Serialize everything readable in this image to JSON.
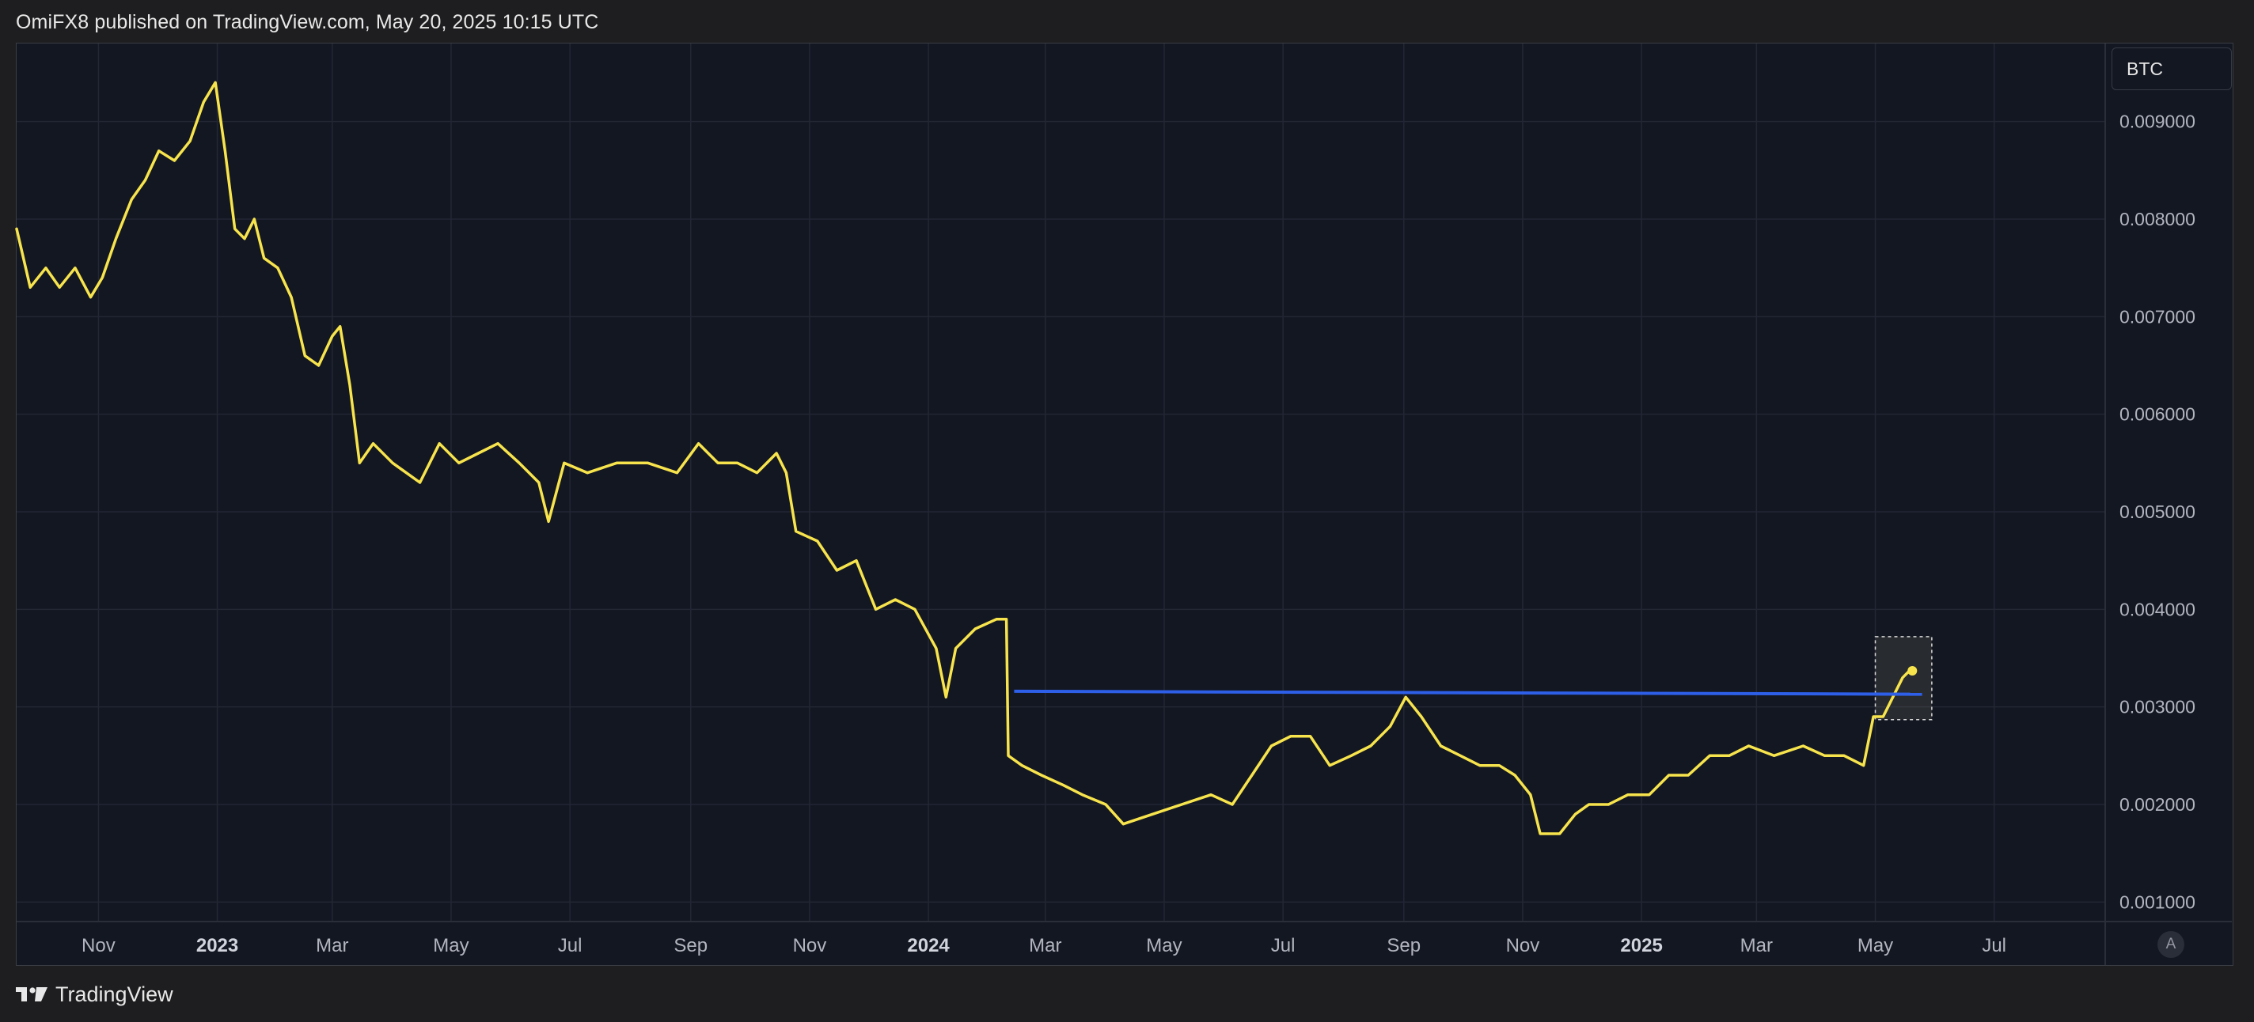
{
  "header": {
    "published_text": "OmiFX8 published on TradingView.com, May 20, 2025 10:15 UTC"
  },
  "symbol": {
    "label": "BTC"
  },
  "scale_button": {
    "label": "A"
  },
  "footer": {
    "brand": "TradingView"
  },
  "colors": {
    "background": "#131722",
    "grid": "#232734",
    "price_line": "#f7e44d",
    "horizontal_line": "#2d5fe8",
    "axis_text": "#b2b5be"
  },
  "chart_data": {
    "type": "line",
    "title": "",
    "xlabel": "",
    "ylabel": "",
    "x_range": [
      "2022-09-20",
      "2025-08-27"
    ],
    "ylim": [
      0.0008,
      0.0098
    ],
    "grid": true,
    "y_ticks": [
      "0.009000",
      "0.008000",
      "0.007000",
      "0.006000",
      "0.005000",
      "0.004000",
      "0.003000",
      "0.002000",
      "0.001000"
    ],
    "x_ticks": [
      {
        "date": "2022-11-01",
        "label": "Nov",
        "bold": false
      },
      {
        "date": "2023-01-01",
        "label": "2023",
        "bold": true
      },
      {
        "date": "2023-03-01",
        "label": "Mar",
        "bold": false
      },
      {
        "date": "2023-05-01",
        "label": "May",
        "bold": false
      },
      {
        "date": "2023-07-01",
        "label": "Jul",
        "bold": false
      },
      {
        "date": "2023-09-01",
        "label": "Sep",
        "bold": false
      },
      {
        "date": "2023-11-01",
        "label": "Nov",
        "bold": false
      },
      {
        "date": "2024-01-01",
        "label": "2024",
        "bold": true
      },
      {
        "date": "2024-03-01",
        "label": "Mar",
        "bold": false
      },
      {
        "date": "2024-05-01",
        "label": "May",
        "bold": false
      },
      {
        "date": "2024-07-01",
        "label": "Jul",
        "bold": false
      },
      {
        "date": "2024-09-01",
        "label": "Sep",
        "bold": false
      },
      {
        "date": "2024-11-01",
        "label": "Nov",
        "bold": false
      },
      {
        "date": "2025-01-01",
        "label": "2025",
        "bold": true
      },
      {
        "date": "2025-03-01",
        "label": "Mar",
        "bold": false
      },
      {
        "date": "2025-05-01",
        "label": "May",
        "bold": false
      },
      {
        "date": "2025-07-01",
        "label": "Jul",
        "bold": false
      }
    ],
    "series": [
      {
        "values": [
          [
            "2022-09-20",
            0.0079
          ],
          [
            "2022-09-27",
            0.0073
          ],
          [
            "2022-10-05",
            0.0075
          ],
          [
            "2022-10-12",
            0.0073
          ],
          [
            "2022-10-20",
            0.0075
          ],
          [
            "2022-10-28",
            0.0072
          ],
          [
            "2022-11-03",
            0.0074
          ],
          [
            "2022-11-10",
            0.0078
          ],
          [
            "2022-11-18",
            0.0082
          ],
          [
            "2022-11-25",
            0.0084
          ],
          [
            "2022-12-02",
            0.0087
          ],
          [
            "2022-12-10",
            0.0086
          ],
          [
            "2022-12-18",
            0.0088
          ],
          [
            "2022-12-25",
            0.0092
          ],
          [
            "2022-12-31",
            0.0094
          ],
          [
            "2023-01-05",
            0.0087
          ],
          [
            "2023-01-10",
            0.0079
          ],
          [
            "2023-01-15",
            0.0078
          ],
          [
            "2023-01-20",
            0.008
          ],
          [
            "2023-01-25",
            0.0076
          ],
          [
            "2023-02-01",
            0.0075
          ],
          [
            "2023-02-08",
            0.0072
          ],
          [
            "2023-02-15",
            0.0066
          ],
          [
            "2023-02-22",
            0.0065
          ],
          [
            "2023-03-01",
            0.0068
          ],
          [
            "2023-03-05",
            0.0069
          ],
          [
            "2023-03-10",
            0.0063
          ],
          [
            "2023-03-15",
            0.0055
          ],
          [
            "2023-03-22",
            0.0057
          ],
          [
            "2023-04-01",
            0.0055
          ],
          [
            "2023-04-15",
            0.0053
          ],
          [
            "2023-04-25",
            0.0057
          ],
          [
            "2023-05-05",
            0.0055
          ],
          [
            "2023-05-15",
            0.0056
          ],
          [
            "2023-05-25",
            0.0057
          ],
          [
            "2023-06-05",
            0.0055
          ],
          [
            "2023-06-15",
            0.0053
          ],
          [
            "2023-06-20",
            0.0049
          ],
          [
            "2023-06-28",
            0.0055
          ],
          [
            "2023-07-10",
            0.0054
          ],
          [
            "2023-07-25",
            0.0055
          ],
          [
            "2023-08-10",
            0.0055
          ],
          [
            "2023-08-25",
            0.0054
          ],
          [
            "2023-09-05",
            0.0057
          ],
          [
            "2023-09-15",
            0.0055
          ],
          [
            "2023-09-25",
            0.0055
          ],
          [
            "2023-10-05",
            0.0054
          ],
          [
            "2023-10-15",
            0.0056
          ],
          [
            "2023-10-20",
            0.0054
          ],
          [
            "2023-10-25",
            0.0048
          ],
          [
            "2023-11-05",
            0.0047
          ],
          [
            "2023-11-15",
            0.0044
          ],
          [
            "2023-11-25",
            0.0045
          ],
          [
            "2023-12-05",
            0.004
          ],
          [
            "2023-12-15",
            0.0041
          ],
          [
            "2023-12-25",
            0.004
          ],
          [
            "2024-01-05",
            0.0036
          ],
          [
            "2024-01-10",
            0.0031
          ],
          [
            "2024-01-15",
            0.0036
          ],
          [
            "2024-01-25",
            0.0038
          ],
          [
            "2024-02-05",
            0.0039
          ],
          [
            "2024-02-10",
            0.0039
          ],
          [
            "2024-02-11",
            0.0025
          ],
          [
            "2024-02-18",
            0.0024
          ],
          [
            "2024-02-28",
            0.0023
          ],
          [
            "2024-03-10",
            0.0022
          ],
          [
            "2024-03-20",
            0.0021
          ],
          [
            "2024-04-01",
            0.002
          ],
          [
            "2024-04-10",
            0.0018
          ],
          [
            "2024-04-25",
            0.0019
          ],
          [
            "2024-05-10",
            0.002
          ],
          [
            "2024-05-25",
            0.0021
          ],
          [
            "2024-06-05",
            0.002
          ],
          [
            "2024-06-15",
            0.0023
          ],
          [
            "2024-06-25",
            0.0026
          ],
          [
            "2024-07-05",
            0.0027
          ],
          [
            "2024-07-15",
            0.0027
          ],
          [
            "2024-07-25",
            0.0024
          ],
          [
            "2024-08-05",
            0.0025
          ],
          [
            "2024-08-15",
            0.0026
          ],
          [
            "2024-08-25",
            0.0028
          ],
          [
            "2024-09-02",
            0.0031
          ],
          [
            "2024-09-10",
            0.0029
          ],
          [
            "2024-09-20",
            0.0026
          ],
          [
            "2024-09-30",
            0.0025
          ],
          [
            "2024-10-10",
            0.0024
          ],
          [
            "2024-10-20",
            0.0024
          ],
          [
            "2024-10-28",
            0.0023
          ],
          [
            "2024-11-05",
            0.0021
          ],
          [
            "2024-11-10",
            0.0017
          ],
          [
            "2024-11-20",
            0.0017
          ],
          [
            "2024-11-28",
            0.0019
          ],
          [
            "2024-12-05",
            0.002
          ],
          [
            "2024-12-15",
            0.002
          ],
          [
            "2024-12-25",
            0.0021
          ],
          [
            "2025-01-05",
            0.0021
          ],
          [
            "2025-01-15",
            0.0023
          ],
          [
            "2025-01-25",
            0.0023
          ],
          [
            "2025-02-05",
            0.0025
          ],
          [
            "2025-02-15",
            0.0025
          ],
          [
            "2025-02-25",
            0.0026
          ],
          [
            "2025-03-10",
            0.0025
          ],
          [
            "2025-03-25",
            0.0026
          ],
          [
            "2025-04-05",
            0.0025
          ],
          [
            "2025-04-15",
            0.0025
          ],
          [
            "2025-04-25",
            0.0024
          ],
          [
            "2025-04-30",
            0.0029
          ],
          [
            "2025-05-05",
            0.0029
          ],
          [
            "2025-05-10",
            0.0031
          ],
          [
            "2025-05-15",
            0.0033
          ],
          [
            "2025-05-20",
            0.0034
          ]
        ]
      }
    ],
    "horizontal_line": {
      "start": "2024-02-14",
      "end": "2025-05-25",
      "value_start": 0.00316,
      "value_end": 0.00313
    },
    "highlight_box": {
      "start": "2025-05-01",
      "end": "2025-05-30",
      "value_low": 0.00287,
      "value_high": 0.00372
    },
    "last_point": {
      "date": "2025-05-20",
      "value": 0.00337
    }
  }
}
